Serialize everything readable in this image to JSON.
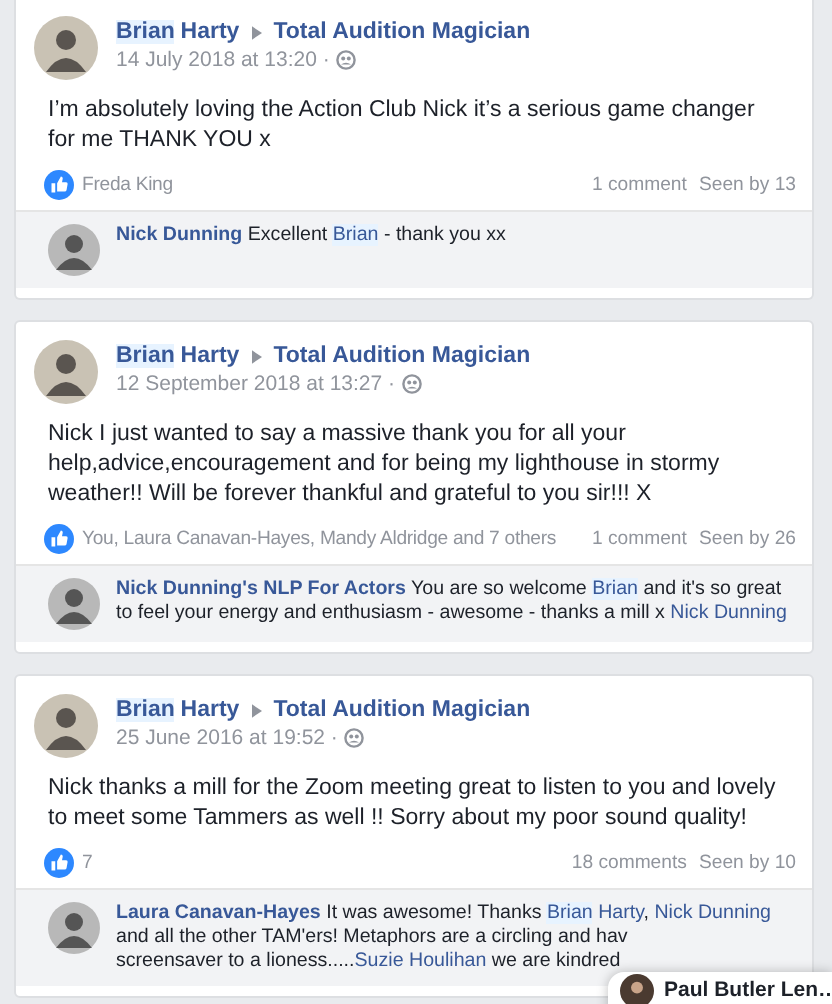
{
  "posts": [
    {
      "author": [
        {
          "text": "Brian",
          "mention": true
        },
        {
          "text": "Harty",
          "mention": false
        }
      ],
      "group": "Total Audition Magician",
      "date": "14 July 2018 at 13:20 ·",
      "text": "I’m absolutely loving the Action Club Nick it’s a serious game changer for me THANK YOU x",
      "reactions": "Freda King",
      "comments": "1 comment",
      "seen": "Seen by 13",
      "comment": {
        "author": "Nick Dunning",
        "segments": [
          {
            "kind": "text",
            "text": "Excellent "
          },
          {
            "kind": "mention",
            "text": "Brian"
          },
          {
            "kind": "text",
            "text": " - thank you xx"
          }
        ]
      }
    },
    {
      "author": [
        {
          "text": "Brian",
          "mention": true
        },
        {
          "text": "Harty",
          "mention": false
        }
      ],
      "group": "Total Audition Magician",
      "date": "12 September 2018 at 13:27 ·",
      "text": "Nick I just wanted to say a massive thank you for all your help,advice,encouragement and for being my lighthouse in stormy weather!! Will be forever thankful and grateful to you sir!!! X",
      "reactions": "You, Laura Canavan-Hayes, Mandy Aldridge and 7 others",
      "comments": "1 comment",
      "seen": "Seen by 26",
      "comment": {
        "author": "Nick Dunning's NLP For Actors",
        "segments": [
          {
            "kind": "text",
            "text": "You are so welcome "
          },
          {
            "kind": "mention",
            "text": "Brian"
          },
          {
            "kind": "text",
            "text": " and it's so great to feel your energy and enthusiasm - awesome - thanks a mill x "
          },
          {
            "kind": "link",
            "text": "Nick Dunning"
          }
        ]
      }
    },
    {
      "author": [
        {
          "text": "Brian",
          "mention": true
        },
        {
          "text": "Harty",
          "mention": false
        }
      ],
      "group": "Total Audition Magician",
      "date": "25 June 2016 at 19:52 ·",
      "text": "Nick thanks a mill for the Zoom meeting great to listen to you and lovely to meet some Tammers as well !! Sorry about my poor sound quality!",
      "reactions": "7",
      "comments": "18 comments",
      "seen": "Seen by 10",
      "comment": {
        "author": "Laura Canavan-Hayes",
        "segments": [
          {
            "kind": "text",
            "text": "It was awesome! Thanks "
          },
          {
            "kind": "mention",
            "text": "Brian",
            "rest": " Harty"
          },
          {
            "kind": "text",
            "text": ", "
          },
          {
            "kind": "link",
            "text": "Nick Dunning"
          },
          {
            "kind": "text",
            "text": " and all the other TAM'ers! Metaphors are a circling and hav"
          },
          {
            "kind": "break"
          },
          {
            "kind": "text",
            "text": "screensaver to a lioness....."
          },
          {
            "kind": "link",
            "text": "Suzie Houlihan"
          },
          {
            "kind": "text",
            "text": " we are kindred"
          }
        ]
      }
    }
  ],
  "chat_popup": {
    "name": "Paul Butler Len…"
  }
}
